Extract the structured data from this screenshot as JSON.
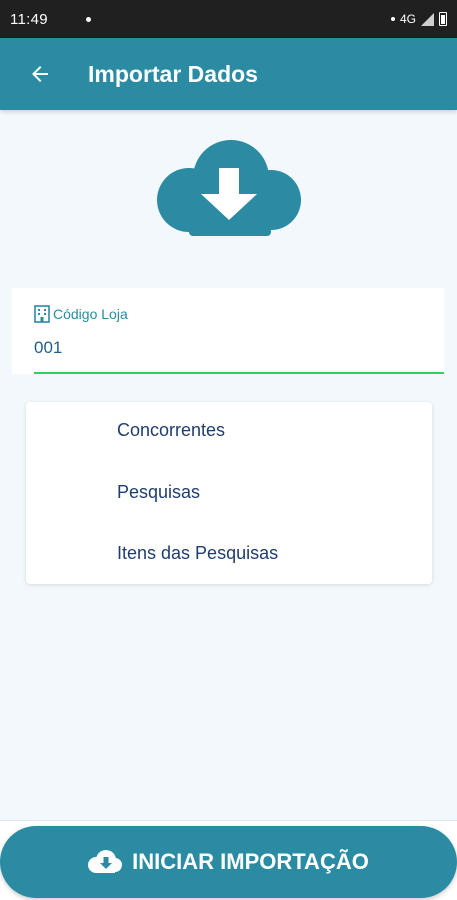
{
  "status_bar": {
    "time": "11:49",
    "network": "4G"
  },
  "app_bar": {
    "title": "Importar Dados",
    "back_icon": "arrow-left-icon"
  },
  "hero": {
    "icon": "cloud-download-icon"
  },
  "store_field": {
    "label": "Código Loja",
    "value": "001",
    "icon": "building-icon"
  },
  "options": [
    {
      "label": "Concorrentes"
    },
    {
      "label": "Pesquisas"
    },
    {
      "label": "Itens das Pesquisas"
    }
  ],
  "import_button": {
    "label": "INICIAR IMPORTAÇÃO",
    "icon": "cloud-download-icon"
  },
  "colors": {
    "primary": "#2a8ba3",
    "background": "#f2f8fb",
    "text_dark": "#1f3d6e",
    "underline": "#2ed35f"
  }
}
